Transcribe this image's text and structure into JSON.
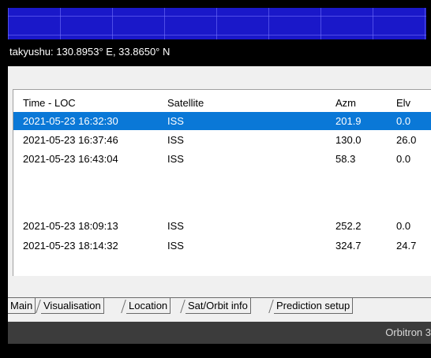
{
  "location": {
    "text": "takyushu: 130.8953° E, 33.8650° N"
  },
  "prediction_table": {
    "columns": [
      "Time - LOC",
      "Satellite",
      "Azm",
      "Elv"
    ],
    "rows": [
      {
        "time": "2021-05-23 16:32:30",
        "satellite": "ISS",
        "azm": "201.9",
        "elv": "0.0",
        "selected": true
      },
      {
        "time": "2021-05-23 16:37:46",
        "satellite": "ISS",
        "azm": "130.0",
        "elv": "26.0"
      },
      {
        "time": "2021-05-23 16:43:04",
        "satellite": "ISS",
        "azm": "58.3",
        "elv": "0.0"
      },
      {
        "time": "2021-05-23 18:09:13",
        "satellite": "ISS",
        "azm": "252.2",
        "elv": "0.0"
      },
      {
        "time": "2021-05-23 18:14:32",
        "satellite": "ISS",
        "azm": "324.7",
        "elv": "24.7"
      }
    ]
  },
  "tabs": [
    "Main",
    "Visualisation",
    "Location",
    "Sat/Orbit info",
    "Prediction setup"
  ],
  "status": {
    "text": "Orbitron 3"
  },
  "colors": {
    "map_blue": "#1a18c9",
    "selection": "#0a78d7",
    "status_bar": "#3c3c3c"
  }
}
